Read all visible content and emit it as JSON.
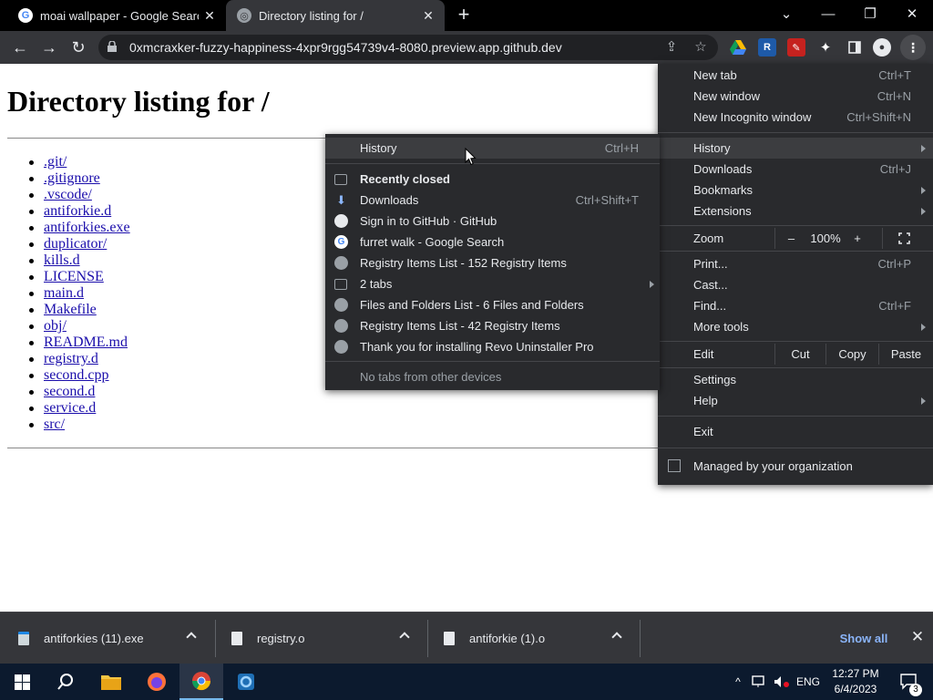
{
  "browser": {
    "tabs": [
      {
        "title": "moai wallpaper - Google Search",
        "favicon": "google-icon"
      },
      {
        "title": "Directory listing for /",
        "favicon": "globe-icon"
      }
    ],
    "url": "0xmcraxker-fuzzy-happiness-4xpr9rgg54739v4-8080.preview.app.github.dev"
  },
  "page": {
    "title": "Directory listing for /",
    "files": [
      ".git/",
      ".gitignore",
      ".vscode/",
      "antiforkie.d",
      "antiforkies.exe",
      "duplicator/",
      "kills.d",
      "LICENSE",
      "main.d",
      "Makefile",
      "obj/",
      "README.md",
      "registry.d",
      "second.cpp",
      "second.d",
      "service.d",
      "src/"
    ]
  },
  "menu": {
    "new_tab": "New tab",
    "new_tab_sc": "Ctrl+T",
    "new_window": "New window",
    "new_window_sc": "Ctrl+N",
    "new_incognito": "New Incognito window",
    "new_incognito_sc": "Ctrl+Shift+N",
    "history": "History",
    "downloads": "Downloads",
    "downloads_sc": "Ctrl+J",
    "bookmarks": "Bookmarks",
    "extensions": "Extensions",
    "zoom": "Zoom",
    "zoom_minus": "–",
    "zoom_level": "100%",
    "zoom_plus": "+",
    "print": "Print...",
    "print_sc": "Ctrl+P",
    "cast": "Cast...",
    "find": "Find...",
    "find_sc": "Ctrl+F",
    "more_tools": "More tools",
    "edit": "Edit",
    "cut": "Cut",
    "copy": "Copy",
    "paste": "Paste",
    "settings": "Settings",
    "help": "Help",
    "exit": "Exit",
    "managed": "Managed by your organization"
  },
  "history_menu": {
    "history": "History",
    "history_sc": "Ctrl+H",
    "recently_closed": "Recently closed",
    "items": [
      {
        "label": "Downloads",
        "shortcut": "Ctrl+Shift+T",
        "icon": "download-icon"
      },
      {
        "label": "Sign in to GitHub · GitHub",
        "icon": "github-icon"
      },
      {
        "label": "furret walk - Google Search",
        "icon": "google-icon"
      },
      {
        "label": "Registry Items List - 152 Registry Items",
        "icon": "globe-icon"
      },
      {
        "label": "2 tabs",
        "icon": "tabs-icon"
      },
      {
        "label": "Files and Folders List - 6 Files and Folders",
        "icon": "globe-icon"
      },
      {
        "label": "Registry Items List - 42 Registry Items",
        "icon": "globe-icon"
      },
      {
        "label": "Thank you for installing Revo Uninstaller Pro",
        "icon": "globe-icon"
      }
    ],
    "no_tabs": "No tabs from other devices"
  },
  "downloads": {
    "items": [
      "antiforkies (11).exe",
      "registry.o",
      "antiforkie (1).o"
    ],
    "show_all": "Show all"
  },
  "taskbar": {
    "language": "ENG",
    "time": "12:27 PM",
    "date": "6/4/2023",
    "notifications": "3"
  }
}
